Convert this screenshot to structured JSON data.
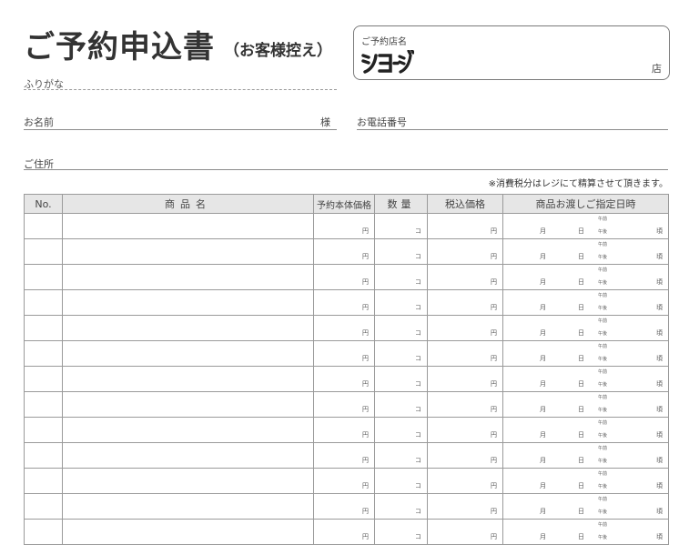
{
  "header": {
    "title": "ご予約申込書",
    "subtitle": "（お客様控え）",
    "furigana_label": "ふりがな"
  },
  "store": {
    "label": "ご予約店名",
    "logo_text": "ショージ",
    "suffix": "店"
  },
  "customer": {
    "name_label": "お名前",
    "name_suffix": "様",
    "phone_label": "お電話番号",
    "address_label": "ご住所"
  },
  "note": "※消費税分はレジにて精算させて頂きます。",
  "table": {
    "headers": {
      "no": "No.",
      "product": "商品名",
      "base_price": "予約本体価格",
      "quantity": "数量",
      "tax_price": "税込価格",
      "delivery": "商品お渡しご指定日時"
    },
    "units": {
      "yen": "円",
      "count": "コ",
      "month": "月",
      "day": "日",
      "am": "午前",
      "pm": "午後",
      "about": "頃"
    },
    "row_count": 13
  }
}
